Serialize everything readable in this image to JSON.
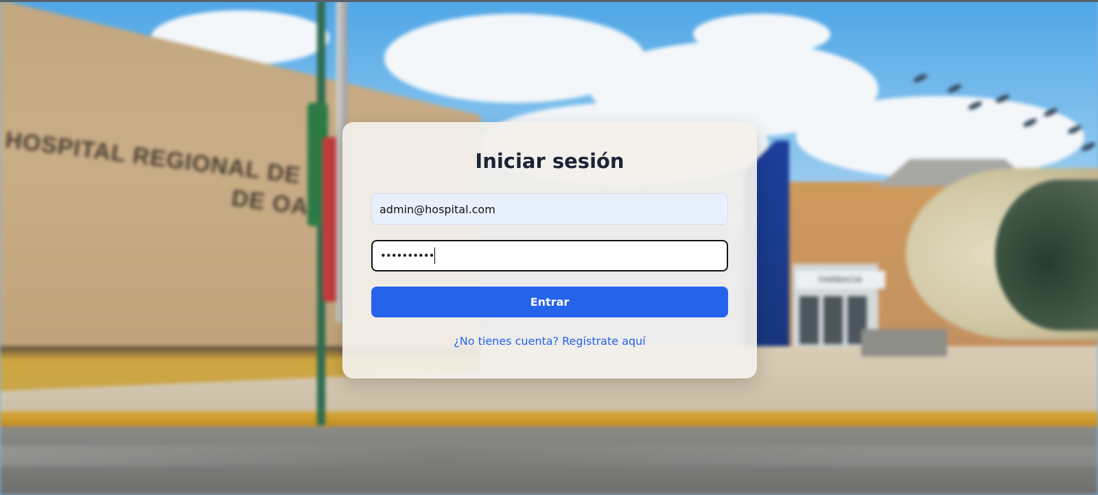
{
  "login": {
    "title": "Iniciar sesión",
    "email_value": "admin@hospital.com",
    "password_masked": "••••••••••",
    "submit_label": "Entrar",
    "register_link": "¿No tienes cuenta? Regístrate aquí"
  },
  "background": {
    "building_sign_line1": "HOSPITAL REGIONAL DE",
    "building_sign_line2": "DE OAX",
    "entrance_sign": "FARMACIA"
  },
  "colors": {
    "primary": "#2563eb",
    "title": "#1b2335",
    "email_autofill_bg": "#e8f0fe",
    "card_bg": "#f3f0ec"
  }
}
